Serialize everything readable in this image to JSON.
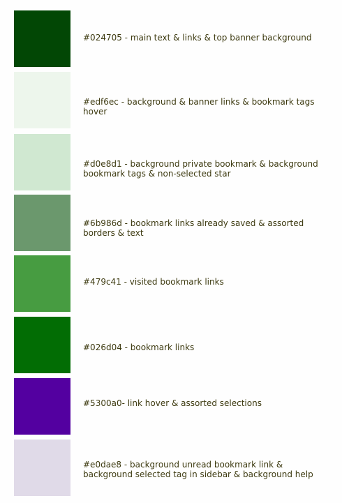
{
  "swatches": [
    {
      "color": "#024705",
      "label": "#024705 - main text & links & top banner background"
    },
    {
      "color": "#edf6ec",
      "label": "#edf6ec - background & banner links & bookmark tags hover"
    },
    {
      "color": "#d0e8d1",
      "label": "#d0e8d1 - background private bookmark & background bookmark tags & non-selected star"
    },
    {
      "color": "#6b986d",
      "label": "#6b986d - bookmark links already saved & assorted borders & text"
    },
    {
      "color": "#479c41",
      "label": "#479c41 - visited bookmark links"
    },
    {
      "color": "#026d04",
      "label": "#026d04 - bookmark links"
    },
    {
      "color": "#5300a0",
      "label": "#5300a0- link hover & assorted selections"
    },
    {
      "color": "#e0dae8",
      "label": "#e0dae8 - background unread bookmark link & background selected tag in sidebar & background help"
    }
  ]
}
